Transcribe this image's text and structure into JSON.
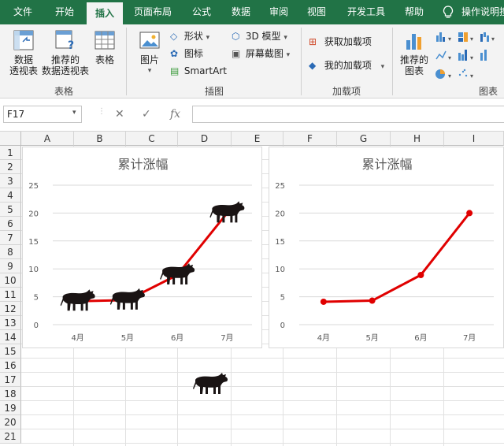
{
  "tabs": [
    "文件",
    "开始",
    "插入",
    "页面布局",
    "公式",
    "数据",
    "审阅",
    "视图",
    "开发工具",
    "帮助"
  ],
  "active_tab": "插入",
  "tell_me": "操作说明搜",
  "ribbon": {
    "tables_group": {
      "label": "表格",
      "pivot": [
        "数据",
        "透视表"
      ],
      "recommended_pivot": [
        "推荐的",
        "数据透视表"
      ],
      "table": "表格"
    },
    "illustrations_group": {
      "label": "插图",
      "pictures": "图片",
      "shapes": "形状",
      "icons": "图标",
      "smartart": "SmartArt",
      "model3d": "3D 模型",
      "screenshot": "屏幕截图"
    },
    "addins_group": {
      "label": "加载项",
      "get_addins": "获取加载项",
      "my_addins": "我的加载项"
    },
    "charts_group": {
      "label": "图表",
      "recommended": [
        "推荐的",
        "图表"
      ]
    }
  },
  "formula_bar": {
    "name_box": "F17",
    "fx": "fx",
    "value": ""
  },
  "columns": [
    "A",
    "B",
    "C",
    "D",
    "E",
    "F",
    "G",
    "H",
    "I"
  ],
  "rows": [
    "1",
    "2",
    "3",
    "4",
    "5",
    "6",
    "7",
    "8",
    "9",
    "10",
    "11",
    "12",
    "13",
    "14",
    "15",
    "16",
    "17",
    "18",
    "19",
    "20",
    "21"
  ],
  "colors": {
    "excel_green": "#217346",
    "line_red": "#e00000",
    "cow": "#1a1414"
  },
  "chart_data": [
    {
      "type": "line",
      "title": "累计涨幅",
      "categories": [
        "4月",
        "5月",
        "6月",
        "7月"
      ],
      "values": [
        4.2,
        4.4,
        8.9,
        20
      ],
      "ylim": [
        0,
        25
      ],
      "yticks": [
        "0",
        "5",
        "10",
        "15",
        "20",
        "25"
      ],
      "markers": "cow-picture",
      "grid": true
    },
    {
      "type": "line",
      "title": "累计涨幅",
      "categories": [
        "4月",
        "5月",
        "6月",
        "7月"
      ],
      "values": [
        4.1,
        4.3,
        8.9,
        20
      ],
      "ylim": [
        0,
        25
      ],
      "yticks": [
        "0",
        "5",
        "10",
        "15",
        "20",
        "25"
      ],
      "markers": "circle",
      "grid": true
    }
  ]
}
